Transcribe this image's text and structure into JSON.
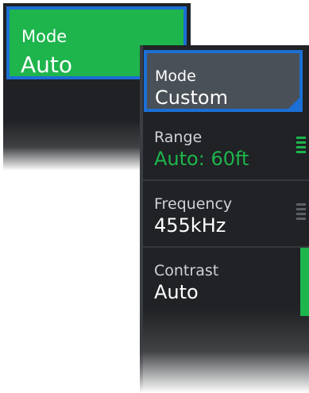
{
  "colors": {
    "accent_green": "#1eb54c",
    "selection_blue": "#1c6fd4",
    "panel_bg": "#202225",
    "tile_gray": "#4a5057"
  },
  "left_panel": {
    "mode_label": "Mode",
    "mode_value": "Auto"
  },
  "right_panel": {
    "mode_label": "Mode",
    "mode_value": "Custom",
    "range": {
      "label": "Range",
      "value": "Auto: 60ft"
    },
    "frequency": {
      "label": "Frequency",
      "value": "455kHz"
    },
    "contrast": {
      "label": "Contrast",
      "value": "Auto"
    }
  },
  "icons": {
    "range_adjust": "menu-lines-icon",
    "frequency_adjust": "menu-lines-icon"
  }
}
